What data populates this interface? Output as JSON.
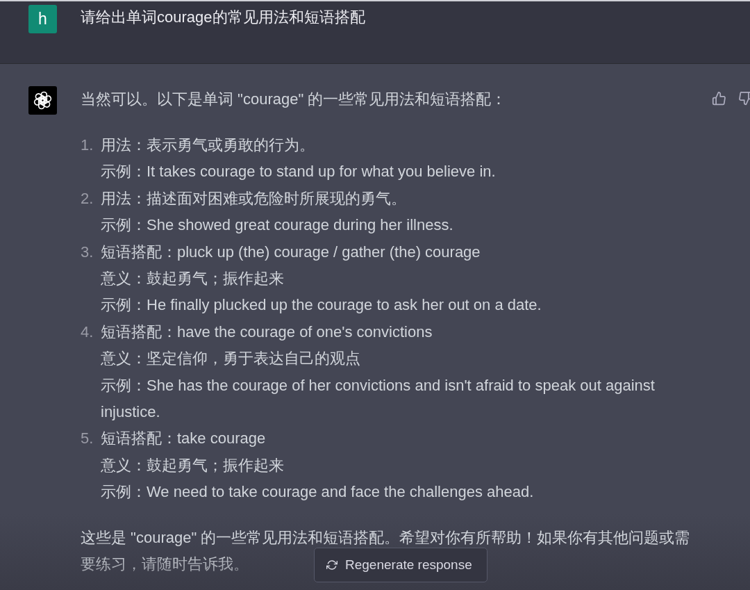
{
  "user_message": {
    "avatar": "h",
    "text": "请给出单词courage的常见用法和短语搭配"
  },
  "assistant_message": {
    "intro": "当然可以。以下是单词 \"courage\" 的一些常见用法和短语搭配：",
    "items": [
      {
        "number": "1.",
        "lines": [
          "用法：表示勇气或勇敢的行为。",
          "示例：It takes courage to stand up for what you believe in."
        ]
      },
      {
        "number": "2.",
        "lines": [
          "用法：描述面对困难或危险时所展现的勇气。",
          "示例：She showed great courage during her illness."
        ]
      },
      {
        "number": "3.",
        "lines": [
          "短语搭配：pluck up (the) courage / gather (the) courage",
          "意义：鼓起勇气；振作起来",
          "示例：He finally plucked up the courage to ask her out on a date."
        ]
      },
      {
        "number": "4.",
        "lines": [
          "短语搭配：have the courage of one's convictions",
          "意义：坚定信仰，勇于表达自己的观点",
          "示例：She has the courage of her convictions and isn't afraid to speak out against injustice."
        ]
      },
      {
        "number": "5.",
        "lines": [
          "短语搭配：take courage",
          "意义：鼓起勇气；振作起来",
          "示例：We need to take courage and face the challenges ahead."
        ]
      }
    ],
    "closing_lines": [
      "这些是 \"courage\" 的一些常见用法和短语搭配。希望对你有所帮助！如果你有其他问题或需",
      "要练习，请随时告诉我。"
    ]
  },
  "regenerate_button": {
    "label": "Regenerate response"
  }
}
